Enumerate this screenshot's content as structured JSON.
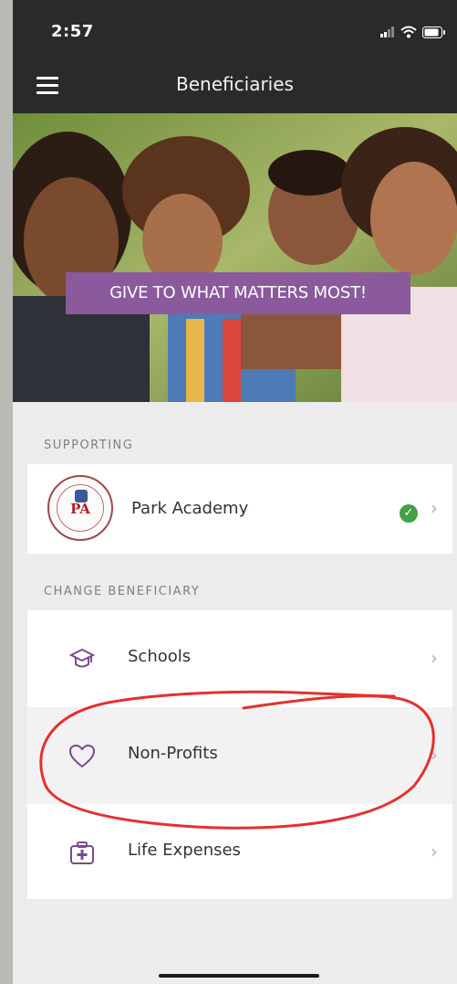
{
  "status_bar": {
    "time": "2:57"
  },
  "nav": {
    "title": "Beneficiaries"
  },
  "hero": {
    "banner_text": "GIVE TO WHAT MATTERS MOST!"
  },
  "supporting": {
    "section_label": "SUPPORTING",
    "name": "Park Academy",
    "logo_text": "PA",
    "status": "selected"
  },
  "change": {
    "section_label": "CHANGE BENEFICIARY",
    "items": [
      {
        "label": "Schools",
        "icon": "graduation-cap-icon"
      },
      {
        "label": "Non-Profits",
        "icon": "heart-icon"
      },
      {
        "label": "Life Expenses",
        "icon": "medical-case-icon"
      }
    ]
  },
  "colors": {
    "accent_purple": "#8a5a9c",
    "check_green": "#43a047",
    "annotation_red": "#e5302f",
    "bar_dark": "#2a2a2a"
  }
}
